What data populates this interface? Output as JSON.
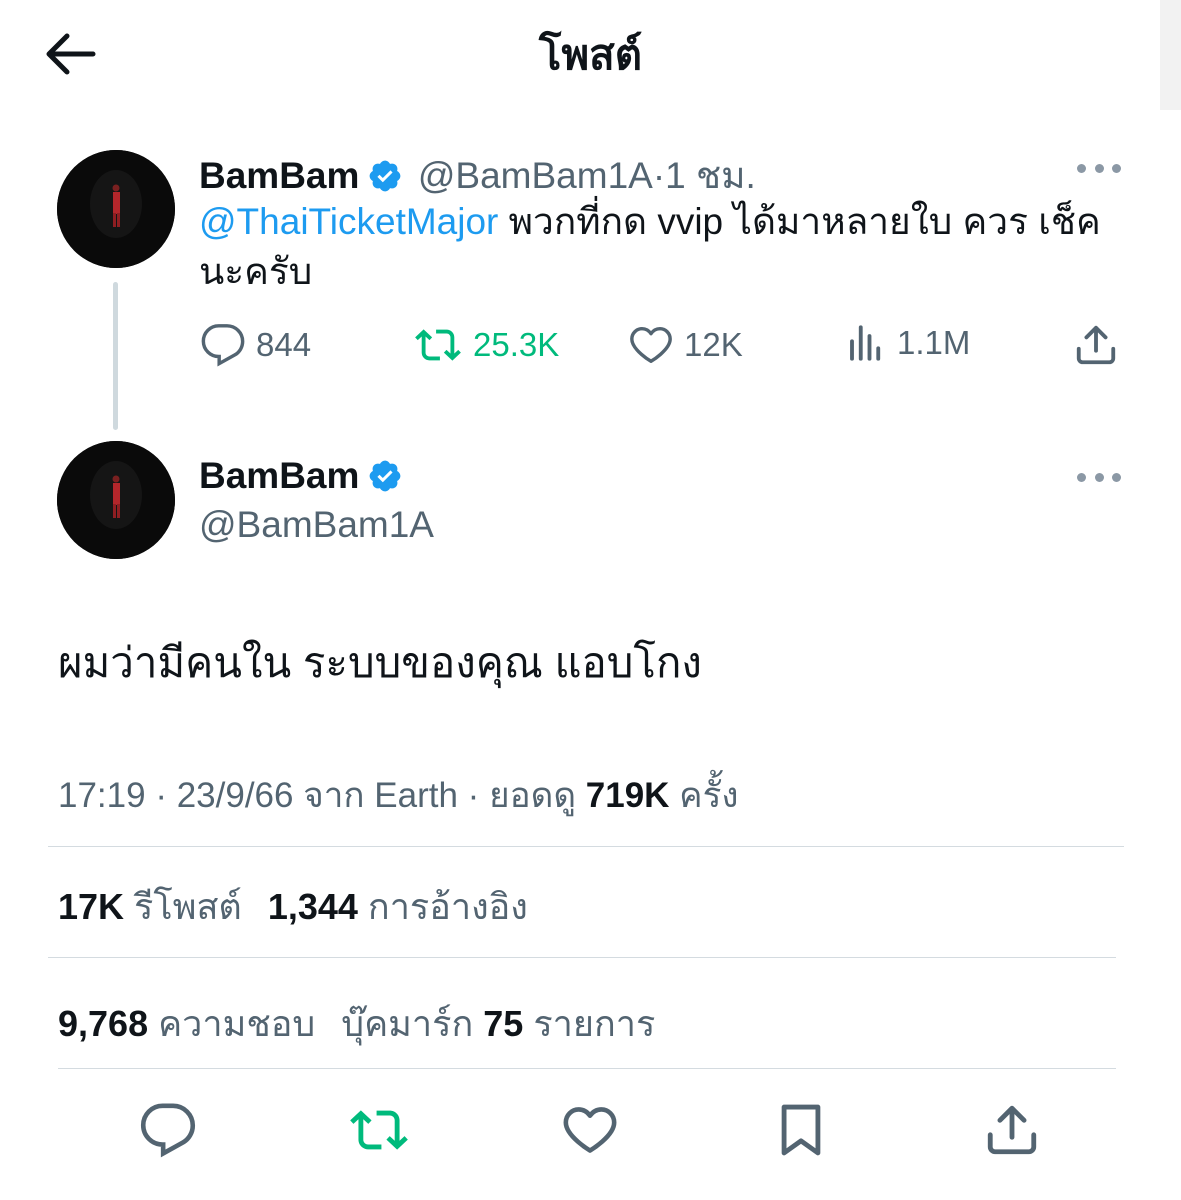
{
  "header": {
    "title": "โพสต์"
  },
  "reply_tweet": {
    "author_name": "BamBam",
    "handle": "@BamBam1A",
    "separator": "·",
    "time": "1 ชม.",
    "mention": "@ThaiTicketMajor",
    "text": " พวกที่กด vvip ได้มาหลายใบ ควร เช็คนะครับ",
    "actions": {
      "replies": "844",
      "reposts": "25.3K",
      "likes": "12K",
      "views": "1.1M"
    }
  },
  "main_tweet": {
    "author_name": "BamBam",
    "handle": "@BamBam1A",
    "text": "ผมว่ามีคนใน ระบบของคุณ แอบโกง",
    "meta": {
      "time": "17:19",
      "sep1": " · ",
      "date": "23/9/66",
      "source_prefix": " จาก ",
      "source": "Earth",
      "sep2": " · ",
      "views_prefix": "ยอดดู ",
      "views": "719K",
      "views_suffix": " ครั้ง"
    },
    "stats": {
      "reposts_count": "17K",
      "reposts_label": " รีโพสต์",
      "quotes_count": "1,344",
      "quotes_label": " การอ้างอิง",
      "likes_count": "9,768",
      "likes_label": " ความชอบ",
      "bookmarks_prefix": "บุ๊คมาร์ก ",
      "bookmarks_count": "75",
      "bookmarks_label": " รายการ"
    }
  },
  "colors": {
    "accent": "#1d9bf0",
    "repost": "#00ba7c",
    "secondary_text": "#536471",
    "primary_text": "#0f1419",
    "divider": "#d4dbe0"
  },
  "icons": {
    "back": "arrow-left-icon",
    "verified": "verified-badge-icon",
    "more": "more-dots-icon",
    "reply": "speech-bubble-icon",
    "repost": "repost-arrows-icon",
    "like": "heart-icon",
    "views": "bar-chart-icon",
    "share": "share-upload-icon",
    "bookmark": "bookmark-icon"
  }
}
